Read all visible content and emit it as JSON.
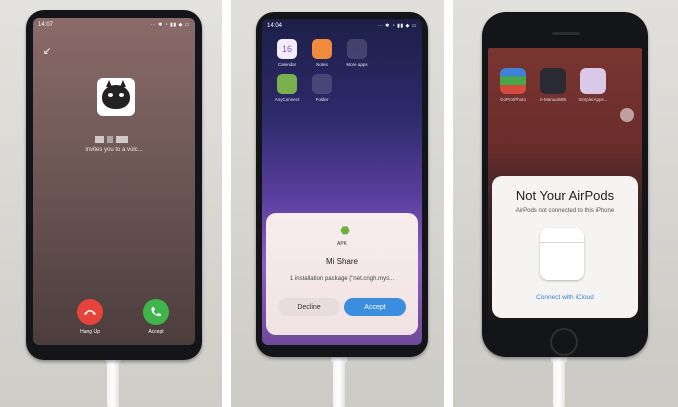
{
  "panel1": {
    "time": "14:07",
    "status_icons": "⋯ ✱ ◔ ▮▮ ◆ ▭",
    "invite_text": "invites you to a voic...",
    "hangup_label": "Hang Up",
    "accept_label": "Accept"
  },
  "panel2": {
    "time": "14:04",
    "status_icons": "⋯ ✱ ◔ ▮▮ ◆ ▭",
    "apps": [
      {
        "label": "Calendar",
        "glyph": "16"
      },
      {
        "label": "Notes",
        "glyph": ""
      },
      {
        "label": "More apps",
        "glyph": ""
      },
      {
        "label": "AnyConnect",
        "glyph": ""
      },
      {
        "label": "Folder",
        "glyph": ""
      }
    ],
    "dialog": {
      "tag": "APK",
      "title": "Mi Share",
      "message": "1 installation package (\"net.crigh.mys...",
      "decline": "Decline",
      "accept": "Accept"
    }
  },
  "panel3": {
    "apps": [
      {
        "label": "GoPro/Photo"
      },
      {
        "label": "e-Manuals88"
      },
      {
        "label": "Simple/Apps..."
      }
    ],
    "card": {
      "title": "Not Your AirPods",
      "subtitle": "AirPods not connected to this iPhone",
      "link": "Connect with iCloud"
    }
  },
  "colors": {
    "hangup": "#e6443b",
    "accept_call": "#3fb54c",
    "accept_button": "#3b8de0",
    "link": "#3a7fd6"
  }
}
